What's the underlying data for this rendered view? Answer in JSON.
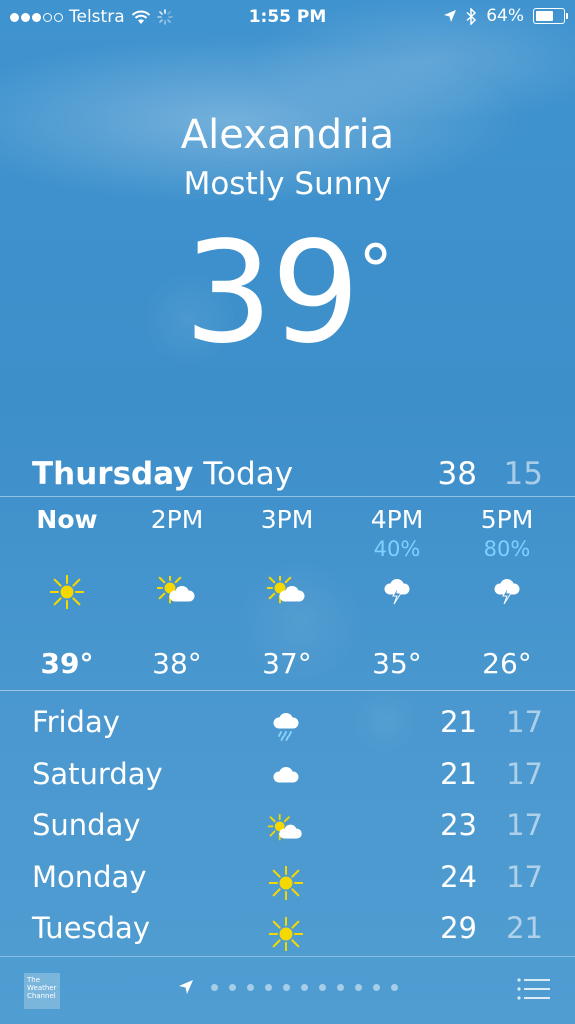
{
  "status": {
    "carrier": "Telstra",
    "time": "1:55 PM",
    "battery": "64%",
    "battery_level": 0.64,
    "signal_dots_filled": 3,
    "signal_dots_total": 5
  },
  "location": {
    "city": "Alexandria",
    "condition": "Mostly Sunny",
    "temperature": "39",
    "degree": "°"
  },
  "today": {
    "day": "Thursday",
    "label": "Today",
    "high": "38",
    "low": "15"
  },
  "hourly": [
    {
      "time": "Now",
      "precip": "",
      "icon": "sun-icon",
      "temp": "39°"
    },
    {
      "time": "2PM",
      "precip": "",
      "icon": "partly-cloudy-icon",
      "temp": "38°"
    },
    {
      "time": "3PM",
      "precip": "",
      "icon": "partly-cloudy-icon",
      "temp": "37°"
    },
    {
      "time": "4PM",
      "precip": "40%",
      "icon": "thunderstorm-icon",
      "temp": "35°"
    },
    {
      "time": "5PM",
      "precip": "80%",
      "icon": "thunderstorm-icon",
      "temp": "26°"
    }
  ],
  "daily": [
    {
      "day": "Friday",
      "icon": "rain-cloud-icon",
      "high": "21",
      "low": "17"
    },
    {
      "day": "Saturday",
      "icon": "cloud-icon",
      "high": "21",
      "low": "17"
    },
    {
      "day": "Sunday",
      "icon": "partly-cloudy-icon",
      "high": "23",
      "low": "17"
    },
    {
      "day": "Monday",
      "icon": "sun-icon",
      "high": "24",
      "low": "17"
    },
    {
      "day": "Tuesday",
      "icon": "sun-icon",
      "high": "29",
      "low": "21"
    }
  ],
  "footer": {
    "provider_logo_text": "The Weather Channel",
    "page_count": 11
  },
  "colors": {
    "precip": "#7fd0ff",
    "sun": "#f5d800",
    "background": "#3f93cf"
  }
}
